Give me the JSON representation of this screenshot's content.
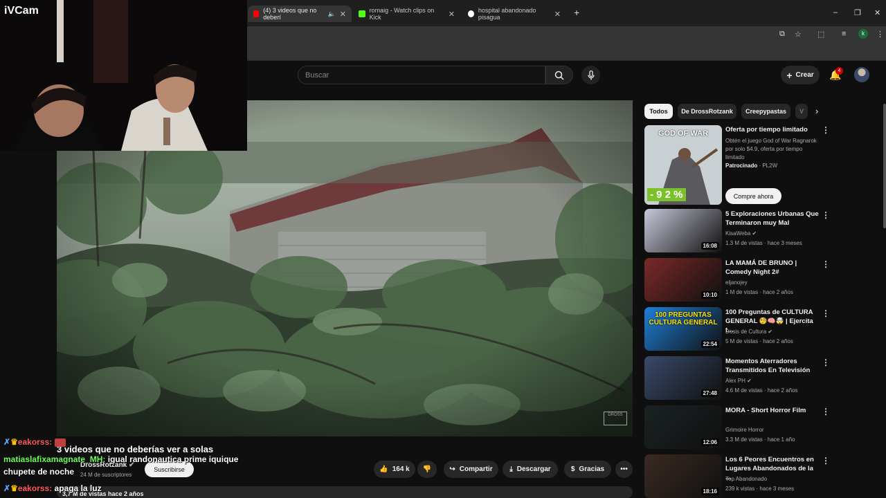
{
  "overlay": {
    "cam_label": "iVCam"
  },
  "browser": {
    "tabs": [
      {
        "label": "(4) 3 videos que no deberí",
        "active": true
      },
      {
        "label": "romaig - Watch clips on Kick",
        "active": false
      },
      {
        "label": "hospital abandonado pisagua",
        "active": false
      }
    ],
    "new_tab": "+",
    "window_controls": {
      "minimize": "–",
      "restore": "❐",
      "close": "✕"
    },
    "profile_initial": "k"
  },
  "youtube": {
    "search_placeholder": "Buscar",
    "create_label": "Crear",
    "notifications": "4"
  },
  "video": {
    "title": "3 videos que no deberías ver a solas",
    "channel": "DrossRotzank",
    "subscribers": "24 M de suscriptores",
    "subscribe_label": "Suscribirse",
    "likes": "164 k",
    "share_label": "Compartir",
    "download_label": "Descargar",
    "thanks_label": "Gracias",
    "description_meta": "3,7 M de vistas  hace 2 años",
    "watermark": "DROSS"
  },
  "chat": [
    {
      "user": "eakorss:",
      "text": "",
      "emote": true
    },
    {
      "user": "matiaslafixamagnate_MH:",
      "text": "igual randonautica prime iquique"
    },
    {
      "user": "",
      "text": "chupete de noche"
    },
    {
      "user": "eakorss:",
      "text": "apaga la luz"
    }
  ],
  "chips": [
    "Todos",
    "De DrossRotzank",
    "Creepypastas",
    "V"
  ],
  "ad": {
    "title": "Oferta por tiempo limitado",
    "body": "Obtén el juego God of War Ragnarok por solo $4.9, oferta por tiempo limitado",
    "sponsored": "Patrocinado",
    "advertiser": "PL2W",
    "cta": "Compre ahora",
    "badge": "- 9 2 %",
    "thumb_text": "GOD OF WAR"
  },
  "recommendations": [
    {
      "title": "5 Exploraciones Urbanas Que Terminaron muy Mal",
      "channel": "KisaWeba",
      "verified": true,
      "meta": "1.3 M de vistas · hace 3 meses",
      "duration": "16:08",
      "color": "#c6c8d8"
    },
    {
      "title": "LA MAMÁ DE BRUNO | Comedy Night 2#",
      "channel": "eljanojey",
      "verified": false,
      "meta": "1 M de vistas · hace 2 años",
      "duration": "10:10",
      "color": "#7a2a28"
    },
    {
      "title": "100 Preguntas de CULTURA GENERAL 🧐🧠🤯 | Ejercita t...",
      "channel": "Dosis de Cultura",
      "verified": true,
      "meta": "5 M de vistas · hace 2 años",
      "duration": "22:54",
      "color": "#1e7fd8",
      "thumb_text": "100 PREGUNTAS CULTURA GENERAL"
    },
    {
      "title": "Momentos Aterradores Transmitidos En Televisión",
      "channel": "Alex PH",
      "verified": true,
      "meta": "4.6 M de vistas · hace 2 años",
      "duration": "27:48",
      "color": "#3a4a6a"
    },
    {
      "title": "MORA - Short Horror Film",
      "channel": "Grimoire Horror",
      "verified": false,
      "meta": "3.3 M de vistas · hace 1 año",
      "duration": "12:06",
      "color": "#1a2222"
    },
    {
      "title": "Los 6 Peores Encuentros en Lugares Abandonados de la ...",
      "channel": "Top Abandonado",
      "verified": false,
      "meta": "239 k vistas · hace 3 meses",
      "duration": "18:16",
      "color": "#3a2a22"
    }
  ]
}
